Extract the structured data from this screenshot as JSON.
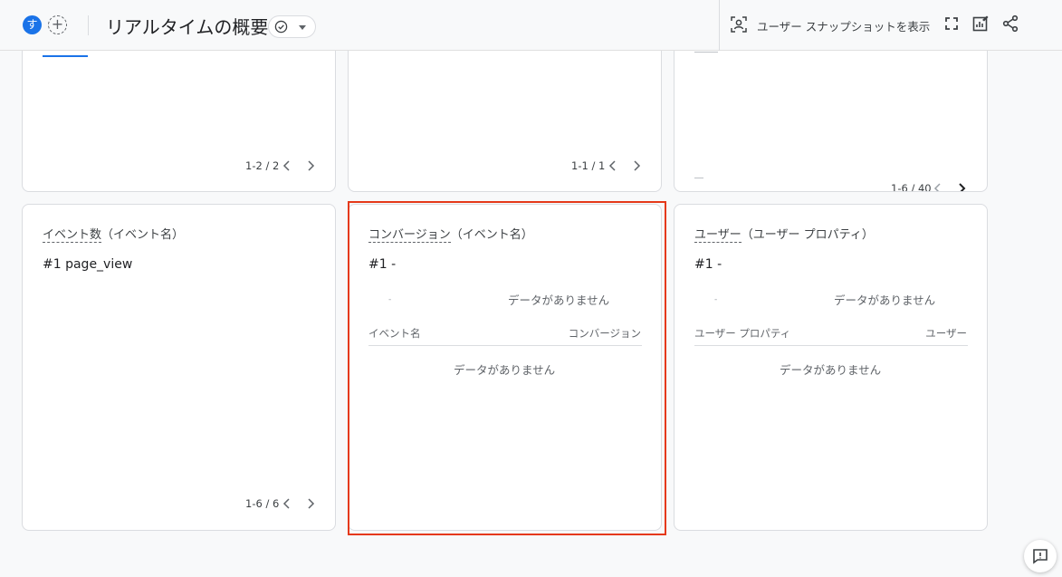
{
  "header": {
    "avatar_letter": "す",
    "add_symbol": "+",
    "title": "リアルタイムの概要",
    "snapshot_label": "ユーザー スナップショットを表示"
  },
  "cards": {
    "top_left": {
      "pager": "1-2 / 2"
    },
    "top_middle": {
      "pager": "1-1 / 1"
    },
    "top_right": {
      "pager": "1-6 / 40"
    },
    "events": {
      "title_main": "イベント数",
      "title_sub": "（イベント名）",
      "rank": "#1  page_view",
      "pager": "1-6 / 6"
    },
    "conversions": {
      "title_main": "コンバージョン",
      "title_sub": "（イベント名）",
      "rank": "#1  -",
      "dash": "-",
      "nodata_top": "データがありません",
      "col_left": "イベント名",
      "col_right": "コンバージョン",
      "nodata_table": "データがありません"
    },
    "users": {
      "title_main": "ユーザー",
      "title_sub": "（ユーザー プロパティ）",
      "rank": "#1  -",
      "dash": "-",
      "nodata_top": "データがありません",
      "col_left": "ユーザー プロパティ",
      "col_right": "ユーザー",
      "nodata_table": "データがありません"
    }
  },
  "colors": {
    "accent": "#1a73e8",
    "highlight": "#e53919"
  },
  "icons": [
    "check-circle-icon",
    "dropdown-caret-icon",
    "user-snapshot-icon",
    "fullscreen-icon",
    "customize-report-icon",
    "share-icon",
    "chevron-left-icon",
    "chevron-right-icon",
    "feedback-icon"
  ]
}
